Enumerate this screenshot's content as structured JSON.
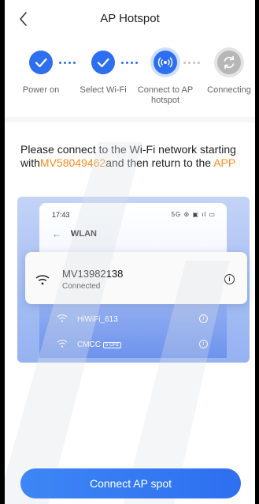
{
  "header": {
    "title": "AP Hotspot"
  },
  "steps": [
    {
      "label": "Power on",
      "state": "done"
    },
    {
      "label": "Select Wi-Fi",
      "state": "done"
    },
    {
      "label": "Connect to AP hotspot",
      "state": "active"
    },
    {
      "label": "Connecting",
      "state": "pending"
    }
  ],
  "instruction": {
    "prefix": "Please connect to the Wi-Fi network starting with",
    "ssid_prefix": "MV58049462",
    "middle": "and then return to the ",
    "app": "APP"
  },
  "illustration": {
    "time": "17:43",
    "status_icons": "5G ⊛ ▣ ıl ▭",
    "wlan_title": "WLAN",
    "connected": {
      "ssid": "MV13982138",
      "state": "Connected"
    },
    "networks": [
      {
        "name": "HiWiFi_613"
      },
      {
        "name": "CMCC",
        "badge": "5 GHz"
      }
    ]
  },
  "footer": {
    "button_label": "Connect AP spot"
  },
  "colors": {
    "accent": "#2d6ff0",
    "highlight": "#ff8a1f"
  }
}
